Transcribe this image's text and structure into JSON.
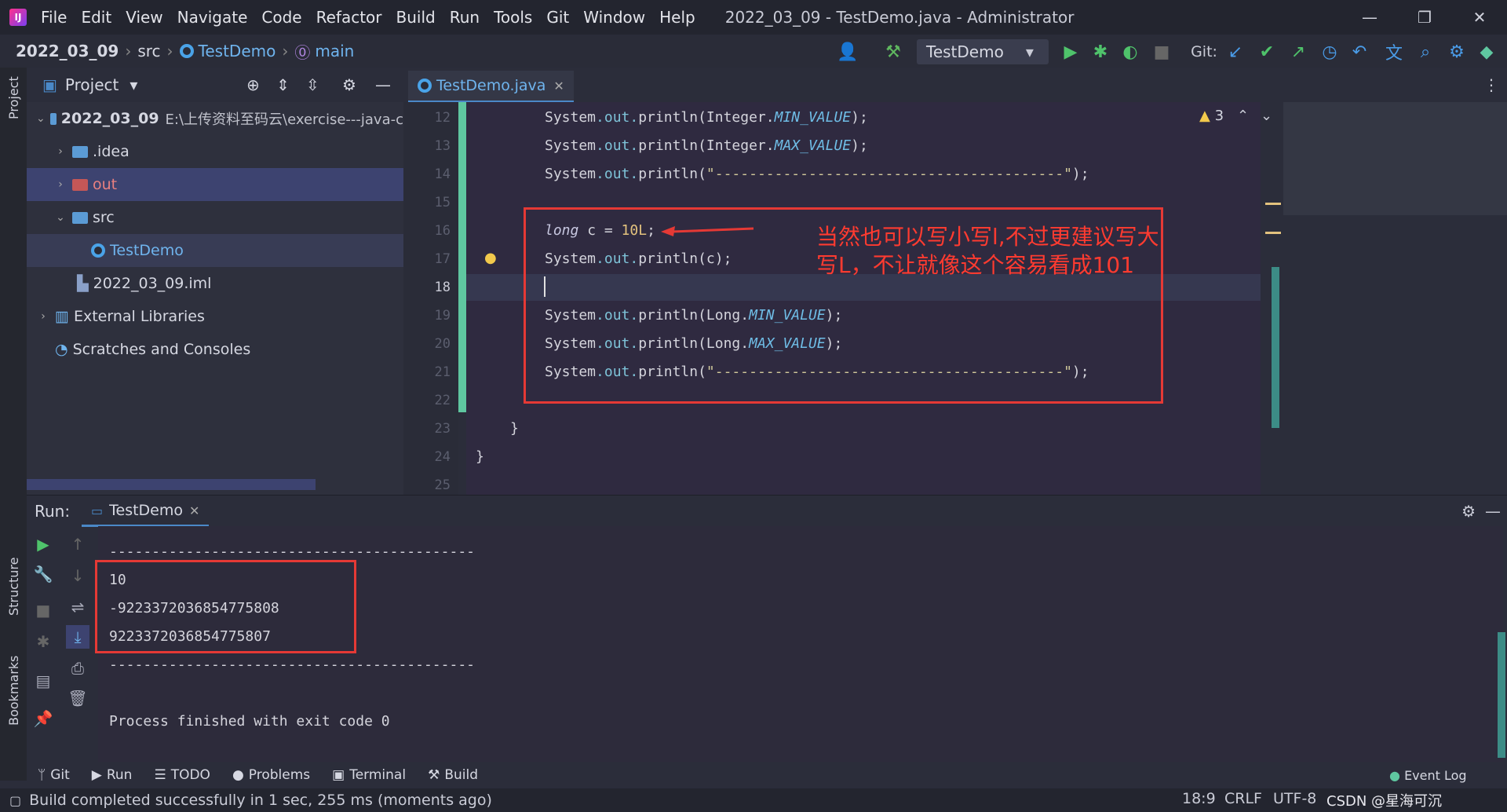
{
  "window": {
    "title": "2022_03_09 - TestDemo.java - Administrator",
    "menu": [
      "File",
      "Edit",
      "View",
      "Navigate",
      "Code",
      "Refactor",
      "Build",
      "Run",
      "Tools",
      "Git",
      "Window",
      "Help"
    ],
    "controls": {
      "minimize": "—",
      "restore": "❐",
      "close": "✕"
    }
  },
  "navbar": {
    "breadcrumbs": [
      "2022_03_09",
      "src",
      "TestDemo",
      "main"
    ],
    "run_config": "TestDemo",
    "git_label": "Git:"
  },
  "left_stripe": {
    "project": "Project",
    "structure": "Structure",
    "bookmarks": "Bookmarks"
  },
  "project": {
    "header": "Project",
    "tree": [
      {
        "label": "2022_03_09",
        "suffix": "E:\\上传资料至码云\\exercise---java-c",
        "type": "root",
        "arrow": "⌄"
      },
      {
        "label": ".idea",
        "type": "folder",
        "arrow": "›"
      },
      {
        "label": "out",
        "type": "folder-red",
        "arrow": "›"
      },
      {
        "label": "src",
        "type": "folder",
        "arrow": "⌄"
      },
      {
        "label": "TestDemo",
        "type": "class"
      },
      {
        "label": "2022_03_09.iml",
        "type": "file"
      },
      {
        "label": "External Libraries",
        "type": "lib",
        "arrow": "›"
      },
      {
        "label": "Scratches and Consoles",
        "type": "scratch"
      }
    ]
  },
  "editor": {
    "tab": "TestDemo.java",
    "warning_count": "3",
    "line_numbers": [
      "12",
      "13",
      "14",
      "15",
      "16",
      "17",
      "18",
      "19",
      "20",
      "21",
      "22",
      "23",
      "24",
      "25"
    ],
    "annotation": "当然也可以写小写l,不过更建议写大写L，不让就像这个容易看成101"
  },
  "run": {
    "label": "Run:",
    "tab": "TestDemo",
    "output": [
      "-------------------------------------------",
      "10",
      "-9223372036854775808",
      "9223372036854775807",
      "-------------------------------------------",
      "",
      "Process finished with exit code 0"
    ]
  },
  "bottom_tools": [
    "Git",
    "Run",
    "TODO",
    "Problems",
    "Terminal",
    "Build"
  ],
  "event_log": "Event Log",
  "status": {
    "message": "Build completed successfully in 1 sec, 255 ms (moments ago)",
    "position": "18:9",
    "line_sep": "CRLF",
    "encoding": "UTF-8",
    "watermark": "CSDN @星海可沉"
  },
  "colors": {
    "accent": "#4a88c7",
    "annotation_red": "#e53935",
    "change_bar": "#5fc7a0"
  }
}
